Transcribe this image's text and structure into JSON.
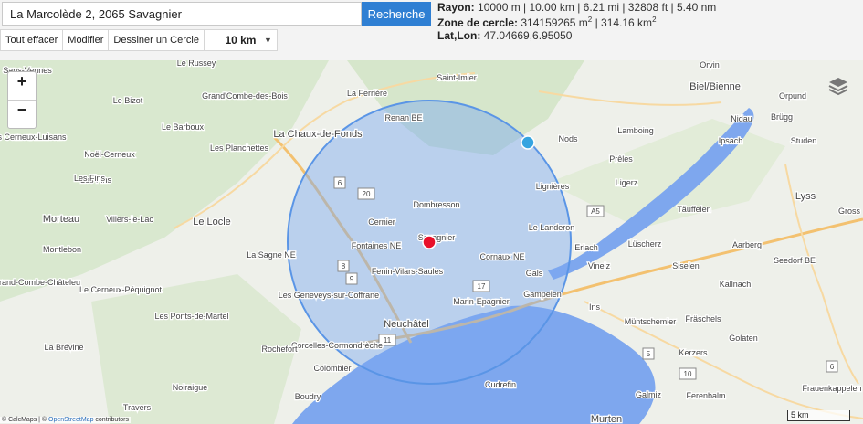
{
  "search": {
    "value": "La Marcolède 2, 2065 Savagnier",
    "button_label": "Recherche"
  },
  "toolbar": {
    "clear_label": "Tout effacer",
    "edit_label": "Modifier",
    "draw_label": "Dessiner un Cercle",
    "radius_select": "10 km"
  },
  "info": {
    "radius_label": "Rayon:",
    "radius_value": "10000 m | 10.00 km | 6.21 mi | 32808 ft | 5.40 nm",
    "area_label": "Zone de cercle:",
    "area_m2": "314159265 m",
    "area_sep": " | 314.16 km",
    "sup2": "2",
    "latlon_label": "Lat,Lon:",
    "latlon_value": "47.04669,6.95050"
  },
  "map": {
    "zoom_in": "+",
    "zoom_out": "−",
    "scale_label": "5 km",
    "attribution_prefix": "© CalcMaps | © ",
    "attribution_link": "OpenStreetMap",
    "attribution_suffix": " contributors",
    "colors": {
      "circle_fill": "#7aa9f2",
      "circle_stroke": "#5a95e6",
      "center_marker": "#e8102a",
      "edge_marker": "#35a4e0",
      "lake": "#7ea7ee"
    },
    "places": [
      "Le Russey",
      "Grand'Combe-des-Bois",
      "La Ferrière",
      "Saint-Imier",
      "Orvin",
      "Biel/Bienne",
      "Orpund",
      "Le Bizot",
      "Le Barboux",
      "La Chaux-de-Fonds",
      "Renan BE",
      "Les Fins",
      "Nidau",
      "Brügg",
      "Les Planchettes",
      "Nods",
      "Ipsach",
      "Studen",
      "Noël-Cerneux",
      "Lamboing",
      "Prêles",
      "Les Fins",
      "Lignières",
      "Ligerz",
      "Lyss",
      "Morteau",
      "Villers-le-Lac",
      "Le Locle",
      "Dombresson",
      "Cernier",
      "Le Landeron",
      "Täuffelen",
      "Savagnier",
      "Fontaines NE",
      "Erlach",
      "Lüscherz",
      "Aarberg",
      "Montlebon",
      "La Sagne NE",
      "Cornaux NE",
      "Fenin-Vilars-Saules",
      "Vinelz",
      "Siselen",
      "Seedorf BE",
      "Le Cerneux-Péquignot",
      "Gals",
      "Gampelen",
      "Kallnach",
      "Les Geneveys-sur-Coffrane",
      "Marin-Epagnier",
      "Ins",
      "Les Ponts-de-Martel",
      "Fräschels",
      "Müntschemier",
      "Neuchâtel",
      "Corcelles-Cormondrèche",
      "Golaten",
      "Rochefort",
      "Kerzers",
      "La Brévine",
      "Colombier",
      "Noiraigue",
      "Boudry",
      "Cudrefin",
      "Galmiz",
      "Ferenbalm",
      "Travers",
      "Murten",
      "Frauenkappelen",
      "Grand-Combe-Châteleu",
      "Sans-Vennes",
      "Les Cerneux-Luisans",
      "Gross"
    ],
    "road_shields": [
      "6",
      "20",
      "8",
      "9",
      "17",
      "11",
      "A5",
      "5",
      "10",
      "6"
    ]
  }
}
